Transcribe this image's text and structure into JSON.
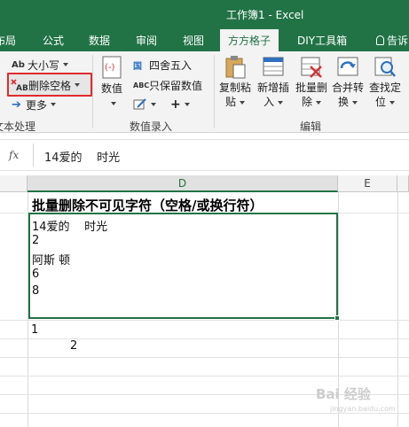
{
  "window": {
    "title": "工作簿1 - Excel"
  },
  "tabs": [
    {
      "label": "布局",
      "active": false
    },
    {
      "label": "公式",
      "active": false
    },
    {
      "label": "数据",
      "active": false
    },
    {
      "label": "审阅",
      "active": false
    },
    {
      "label": "视图",
      "active": false
    },
    {
      "label": "方方格子",
      "active": true
    },
    {
      "label": "DIY工具箱",
      "active": false
    }
  ],
  "tellme": "告诉",
  "ribbon": {
    "text_group": {
      "case_button": "大小写",
      "delete_spaces_button": "删除空格",
      "more_button": "更多",
      "label": "文本处理",
      "case_icon": "Ab",
      "spaces_icon": "AB"
    },
    "number_group": {
      "numeric_button": "数值",
      "round_button": "四舍五入",
      "keep_numeric_button": "只保留数值",
      "round_icon": "国",
      "keep_icon": "ABC",
      "label": "数值录入"
    },
    "edit_group": {
      "copy_paste": [
        "复制粘",
        "贴"
      ],
      "insert": [
        "新增插",
        "入"
      ],
      "batch_delete": [
        "批量删",
        "除"
      ],
      "merge_convert": [
        "合并转",
        "换"
      ],
      "find_locate": [
        "查找定",
        "位"
      ],
      "label": "编辑"
    }
  },
  "formula_bar": {
    "fx": "fx",
    "value": "14爱的    时光"
  },
  "columns": {
    "d": "D",
    "e": "E"
  },
  "sheet": {
    "title": "批量删除不可见字符（空格/或换行符）",
    "cell_lines": [
      "14爱的    时光",
      "2",
      "阿斯 顿",
      "6",
      "8"
    ],
    "below1": "1",
    "below2": "2"
  },
  "watermark": {
    "main": "Bai 经验",
    "sub": "jingyan.baidu.com"
  },
  "colors": {
    "excel_green": "#217346",
    "highlight_red": "#e02b2b"
  }
}
